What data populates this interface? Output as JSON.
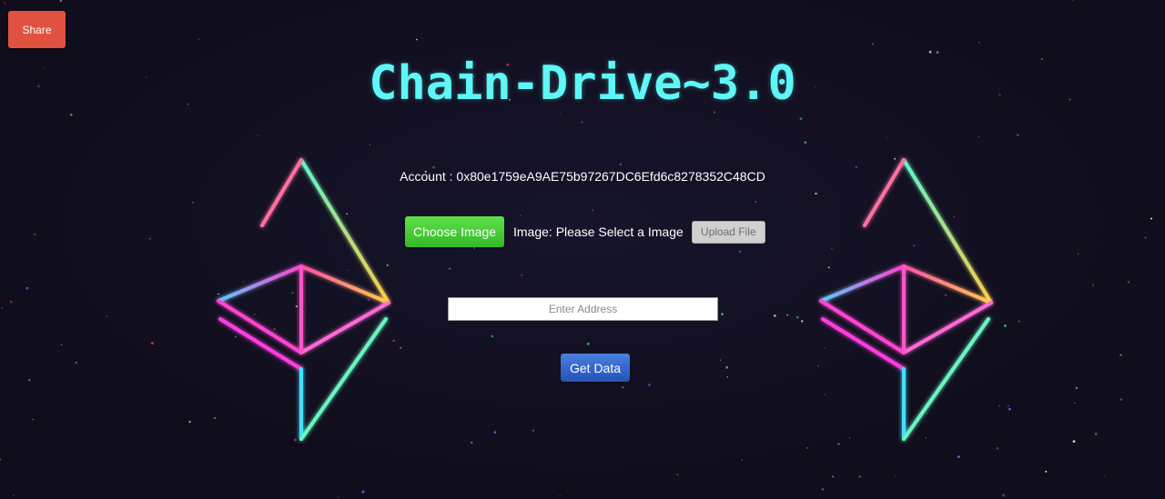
{
  "share_button": {
    "label": "Share"
  },
  "title": "Chain-Drive~3.0",
  "account": {
    "text": "Account : 0x80e1759eA9AE75b97267DC6Efd6c8278352C48CD"
  },
  "upload": {
    "choose_label": "Choose Image",
    "image_status": "Image: Please Select a Image",
    "upload_label": "Upload File"
  },
  "address_input": {
    "placeholder": "Enter Address",
    "value": ""
  },
  "get_data_button": {
    "label": "Get Data"
  },
  "icons": {
    "left_logo": "ethereum-logo-icon",
    "right_logo": "ethereum-logo-icon"
  },
  "colors": {
    "background": "#100e1c",
    "title": "#5ef6f6",
    "share": "#e0523f",
    "choose": "#46cc36",
    "get_data": "#2f63cc",
    "upload_disabled": "#d0d0d0"
  }
}
